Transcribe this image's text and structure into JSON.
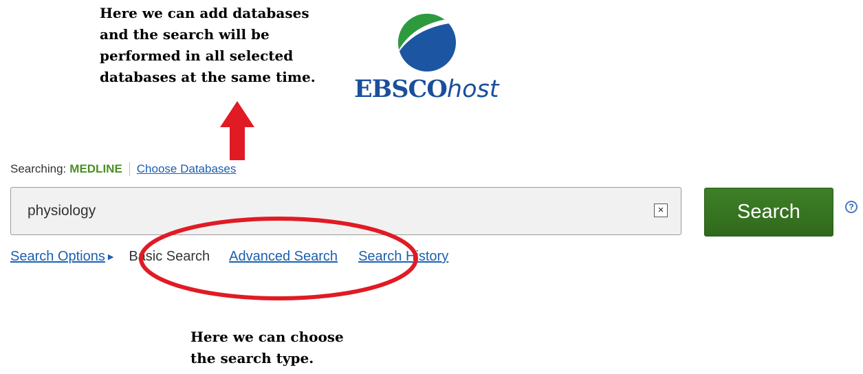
{
  "annotations": {
    "top_note": "Here we can add databases\nand the search will be\nperformed in all selected\ndatabases at the same time.",
    "bottom_note": "Here we can choose\nthe search type."
  },
  "logo": {
    "brand_main": "EBSCO",
    "brand_suffix": "host"
  },
  "searching": {
    "label": "Searching:",
    "database": "MEDLINE",
    "choose_link": "Choose Databases"
  },
  "search": {
    "query": "physiology",
    "clear_symbol": "×",
    "button_label": "Search",
    "help_symbol": "?"
  },
  "options": {
    "search_options": "Search Options",
    "basic_search": "Basic Search",
    "advanced_search": "Advanced Search",
    "search_history": "Search History"
  },
  "colors": {
    "search_button": "#3f7f27",
    "database_name": "#4a8f25",
    "link": "#1b5fb0",
    "annotation_red": "#e01b24",
    "logo_blue": "#1a4f9c",
    "logo_green": "#2e9a3e"
  }
}
